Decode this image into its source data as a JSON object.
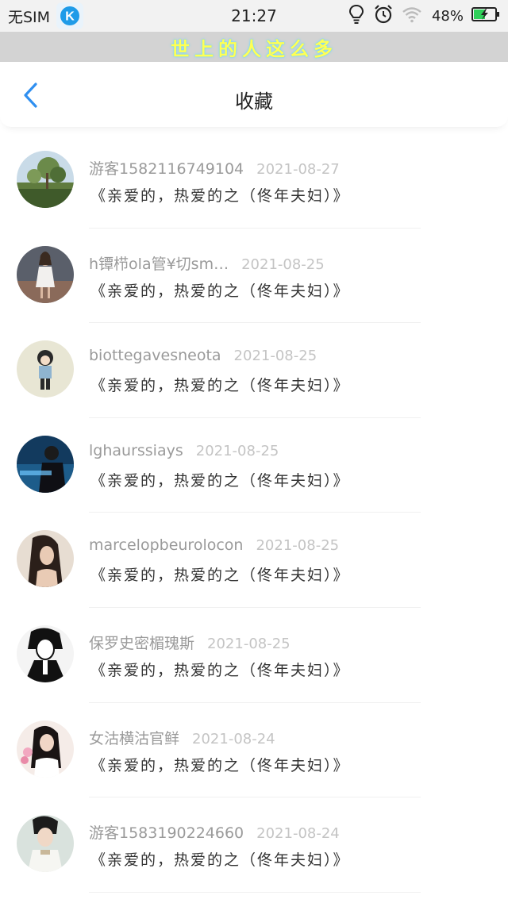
{
  "status": {
    "carrier": "无SIM",
    "app_letter": "K",
    "time": "21:27",
    "battery": "48%"
  },
  "banner": {
    "text": "世上的人这么多"
  },
  "nav": {
    "title": "收藏",
    "back_icon": "chevron-left-icon"
  },
  "colors": {
    "accent": "#2f8ff0",
    "banner_bg": "#d3d3d3",
    "banner_text": "#ffff55",
    "name": "#9a9a9a",
    "date": "#c4c4c4"
  },
  "favorites": [
    {
      "name": "游客1582116749104",
      "date": "2021-08-27",
      "content": "《亲爱的，热爱的之（佟年夫妇）》",
      "avatar": "landscape-trees"
    },
    {
      "name": "h镡栉ola管¥切sm…",
      "date": "2021-08-25",
      "content": "《亲爱的，热爱的之（佟年夫妇）》",
      "avatar": "girl-white-dress"
    },
    {
      "name": "biottegavesneota",
      "date": "2021-08-25",
      "content": "《亲爱的，热爱的之（佟年夫妇）》",
      "avatar": "cartoon-girl"
    },
    {
      "name": "lghaurssiays",
      "date": "2021-08-25",
      "content": "《亲爱的，热爱的之（佟年夫妇）》",
      "avatar": "blue-night-boy"
    },
    {
      "name": "marcelopbeurolocon",
      "date": "2021-08-25",
      "content": "《亲爱的，热爱的之（佟年夫妇）》",
      "avatar": "long-hair-girl"
    },
    {
      "name": "保罗史密楣瑰斯",
      "date": "2021-08-25",
      "content": "《亲爱的，热爱的之（佟年夫妇）》",
      "avatar": "manga-bw"
    },
    {
      "name": "女沽横沽官鲜",
      "date": "2021-08-24",
      "content": "《亲爱的，热爱的之（佟年夫妇）》",
      "avatar": "girl-flowers"
    },
    {
      "name": "游客1583190224660",
      "date": "2021-08-24",
      "content": "《亲爱的，热爱的之（佟年夫妇）》",
      "avatar": "costume-man"
    }
  ]
}
